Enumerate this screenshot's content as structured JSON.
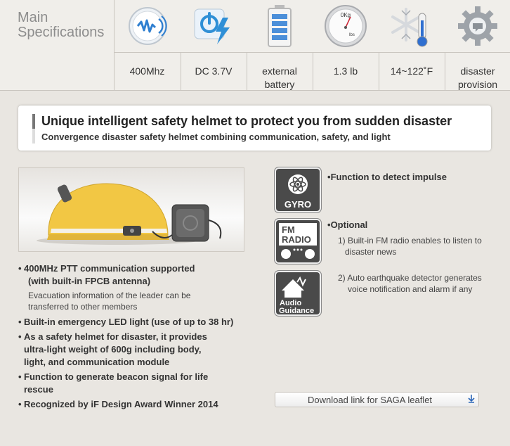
{
  "header": {
    "title_line1": "Main",
    "title_line2": "Specifications"
  },
  "specs": [
    {
      "icon": "radio-wave-icon",
      "label": "400Mhz"
    },
    {
      "icon": "power-lightning-icon",
      "label": "DC 3.7V"
    },
    {
      "icon": "battery-icon",
      "label": "external battery"
    },
    {
      "icon": "scale-gauge-icon",
      "label": "1.3 lb",
      "gauge_top": "0Kg",
      "gauge_unit": "lbs"
    },
    {
      "icon": "snowflake-thermometer-icon",
      "label": "14~122˚F"
    },
    {
      "icon": "gear-icon",
      "label_line1": "disaster",
      "label_line2": "provision"
    }
  ],
  "banner": {
    "title": "Unique intelligent safety helmet to protect you from sudden disaster",
    "subtitle": "Convergence disaster safety helmet combining communication, safety, and light"
  },
  "features": [
    {
      "title_line1": "400MHz PTT communication supported",
      "title_line2": "(with built-in FPCB antenna)",
      "sub_line1": "Evacuation information of the leader can be",
      "sub_line2": "transferred to other members"
    },
    {
      "title_line1": "Built-in emergency LED light (use of up to 38 hr)"
    },
    {
      "title_line1": "As a safety helmet for disaster, it provides",
      "title_line2": "ultra-light weight of 600g including body,",
      "title_line3": "light, and communication module"
    },
    {
      "title_line1": "Function to generate beacon signal for life",
      "title_line2": "rescue"
    },
    {
      "title_line1": "Recognized by iF Design Award Winner 2014"
    }
  ],
  "functions": {
    "gyro_label": "GYRO",
    "impulse": "Function to detect impulse",
    "fm_label_1": "FM",
    "fm_label_2": "RADIO",
    "optional": "Optional",
    "opt1_line1": "1) Built-in FM radio enables to listen to",
    "opt1_line2": "disaster news",
    "opt2_line1": "2) Auto earthquake detector generates",
    "opt2_line2": "voice notification and alarm if any",
    "audio_label_1": "Audio",
    "audio_label_2": "Guidance"
  },
  "download": {
    "label": "Download link for SAGA leaflet"
  },
  "colors": {
    "helmet": "#f2c744",
    "download_icon": "#2b66b8",
    "power_icon": "#2f8fd6"
  }
}
